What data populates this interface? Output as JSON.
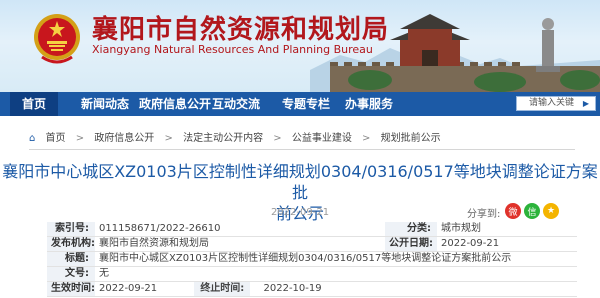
{
  "site": {
    "title": "襄阳市自然资源和规划局",
    "subtitle": "Xiangyang Natural Resources And Planning Bureau"
  },
  "colors": {
    "nav_bg": "#1c5aa6",
    "title_red": "#b2171c",
    "link_blue": "#1c5aa6"
  },
  "nav": {
    "items": [
      "首页",
      "新闻动态",
      "政府信息公开",
      "互动交流",
      "专题专栏",
      "办事服务"
    ]
  },
  "search": {
    "placeholder": "请输入关键"
  },
  "breadcrumb": {
    "items": [
      "首页",
      "政府信息公开",
      "法定主动公开内容",
      "公益事业建设",
      "规划批前公示"
    ],
    "separator": ">"
  },
  "article": {
    "title_line1": "襄阳市中心城区XZ0103片区控制性详细规划0304/0316/0517等地块调整论证方案批",
    "title_line2": "前公示",
    "date": "2022-09-21"
  },
  "share": {
    "label": "分享到:"
  },
  "meta": {
    "index_label": "索引号:",
    "index_value": "011158671/2022-26610",
    "topic_label": "分类:",
    "topic_value": "城市规划",
    "publisher_label": "发布机构:",
    "publisher_value": "襄阳市自然资源和规划局",
    "date_label": "公开日期:",
    "date_value": "2022-09-21",
    "title_label": "标题:",
    "title_value": "襄阳市中心城区XZ0103片区控制性详细规划0304/0316/0517等地块调整论证方案批前公示",
    "docno_label": "文号:",
    "docno_value": "无",
    "effective_label": "生效时间:",
    "effective_value": "2022-09-21",
    "expire_label": "终止时间:",
    "expire_value": "2022-10-19"
  }
}
